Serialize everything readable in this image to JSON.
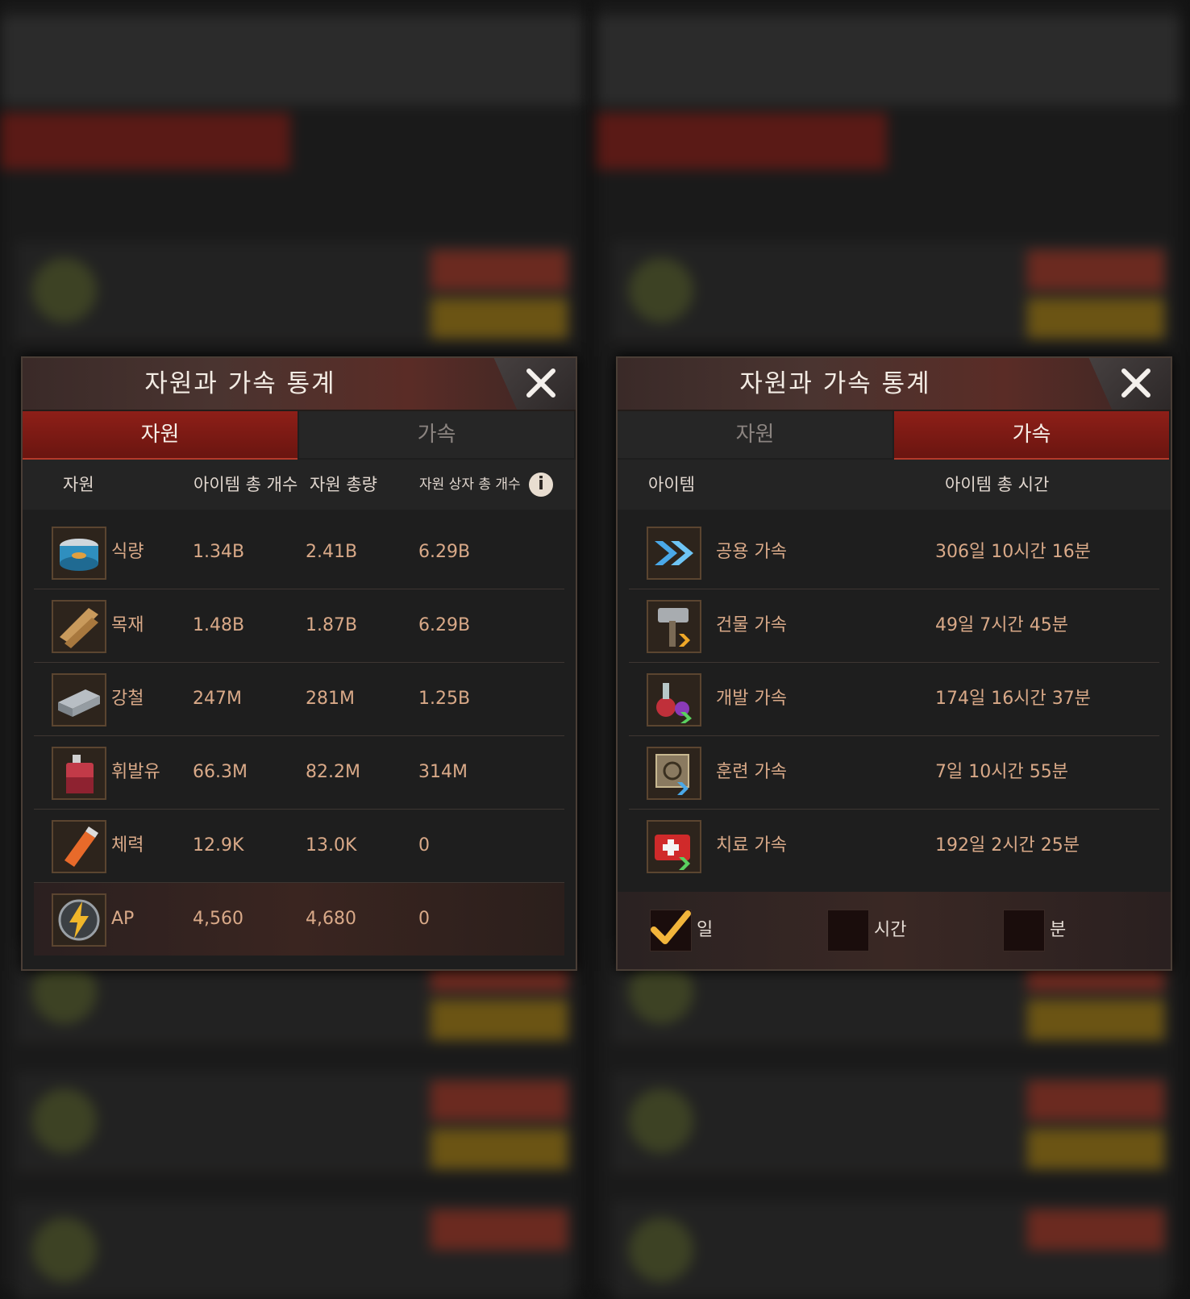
{
  "colors": {
    "tab_active": "#8e1f18",
    "value_text": "#d9a988",
    "header_text": "#e0d6ce",
    "check": "#f2b53b"
  },
  "panel_resources": {
    "title": "자원과 가속 통계",
    "tabs": [
      {
        "label": "자원",
        "active": true
      },
      {
        "label": "가속",
        "active": false
      }
    ],
    "columns": [
      "자원",
      "아이템 총 개수",
      "자원 총량",
      "자원 상자 총 개수"
    ],
    "info_icon": "info-icon",
    "rows": [
      {
        "icon": "food-can-icon",
        "name": "식량",
        "items": "1.34B",
        "total": "2.41B",
        "boxes": "6.29B"
      },
      {
        "icon": "wood-icon",
        "name": "목재",
        "items": "1.48B",
        "total": "1.87B",
        "boxes": "6.29B"
      },
      {
        "icon": "steel-icon",
        "name": "강철",
        "items": "247M",
        "total": "281M",
        "boxes": "1.25B"
      },
      {
        "icon": "fuel-can-icon",
        "name": "휘발유",
        "items": "66.3M",
        "total": "82.2M",
        "boxes": "314M"
      },
      {
        "icon": "stamina-icon",
        "name": "체력",
        "items": "12.9K",
        "total": "13.0K",
        "boxes": "0"
      },
      {
        "icon": "ap-lightning-icon",
        "name": "AP",
        "items": "4,560",
        "total": "4,680",
        "boxes": "0"
      }
    ]
  },
  "panel_speedups": {
    "title": "자원과 가속 통계",
    "tabs": [
      {
        "label": "자원",
        "active": false
      },
      {
        "label": "가속",
        "active": true
      }
    ],
    "columns": [
      "아이템",
      "아이템 총 시간"
    ],
    "rows": [
      {
        "icon": "general-speedup-icon",
        "name": "공용 가속",
        "time": "306일 10시간 16분"
      },
      {
        "icon": "building-speedup-icon",
        "name": "건물 가속",
        "time": "49일 7시간 45분"
      },
      {
        "icon": "research-speedup-icon",
        "name": "개발 가속",
        "time": "174일 16시간 37분"
      },
      {
        "icon": "training-speedup-icon",
        "name": "훈련 가속",
        "time": "7일 10시간 55분"
      },
      {
        "icon": "healing-speedup-icon",
        "name": "치료 가속",
        "time": "192일 2시간 25분"
      }
    ],
    "units": [
      {
        "label": "일",
        "checked": true
      },
      {
        "label": "시간",
        "checked": false
      },
      {
        "label": "분",
        "checked": false
      }
    ]
  }
}
